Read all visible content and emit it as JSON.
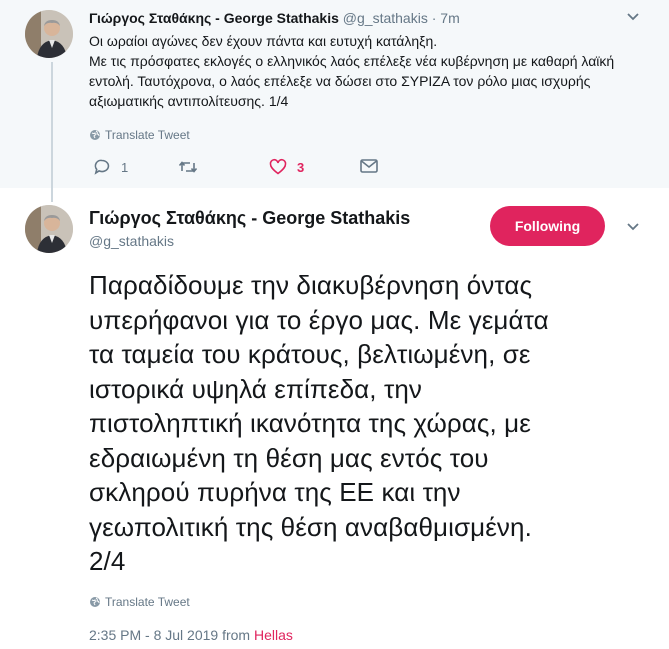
{
  "parent_tweet": {
    "name": "Γιώργος Σταθάκης - George Stathakis",
    "handle": "@g_stathakis",
    "separator": "·",
    "time": "7m",
    "body_lines": [
      "Οι ωραίοι αγώνες δεν έχουν πάντα και ευτυχή κατάληξη.",
      "Με τις πρόσφατες εκλογές ο ελληνικός λαός επέλεξε νέα κυβέρνηση με καθαρή λαϊκή εντολή. Ταυτόχρονα, ο λαός επέλεξε να δώσει στο ΣΥΡΙΖΑ τον ρόλο μιας ισχυρής αξιωματικής αντιπολίτευσης. 1/4"
    ],
    "translate_label": "Translate Tweet",
    "reply_count": "1",
    "like_count": "3",
    "icons": [
      "reply-icon",
      "retweet-icon",
      "heart-icon",
      "message-icon"
    ]
  },
  "main_tweet": {
    "name": "Γιώργος Σταθάκης - George Stathakis",
    "handle": "@g_stathakis",
    "follow_label": "Following",
    "body_lines": [
      "Παραδίδουμε την διακυβέρνηση όντας",
      "υπερήφανοι για το έργο μας. Με γεμάτα",
      "τα ταμεία του κράτους, βελτιωμένη, σε",
      "ιστορικά υψηλά επίπεδα, την",
      "πιστοληπτική ικανότητα της χώρας, με",
      "εδραιωμένη τη θέση μας εντός του",
      "σκληρού πυρήνα της ΕΕ και την",
      "γεωπολιτική της θέση αναβαθμισμένη.",
      "2/4"
    ],
    "translate_label": "Translate Tweet",
    "timestamp": "2:35 PM - 8 Jul 2019",
    "from_label": "from",
    "source": "Hellas"
  },
  "colors": {
    "accent": "#e0245e",
    "text": "#14171a",
    "muted": "#657786",
    "parent_bg": "#f5f8fa"
  }
}
